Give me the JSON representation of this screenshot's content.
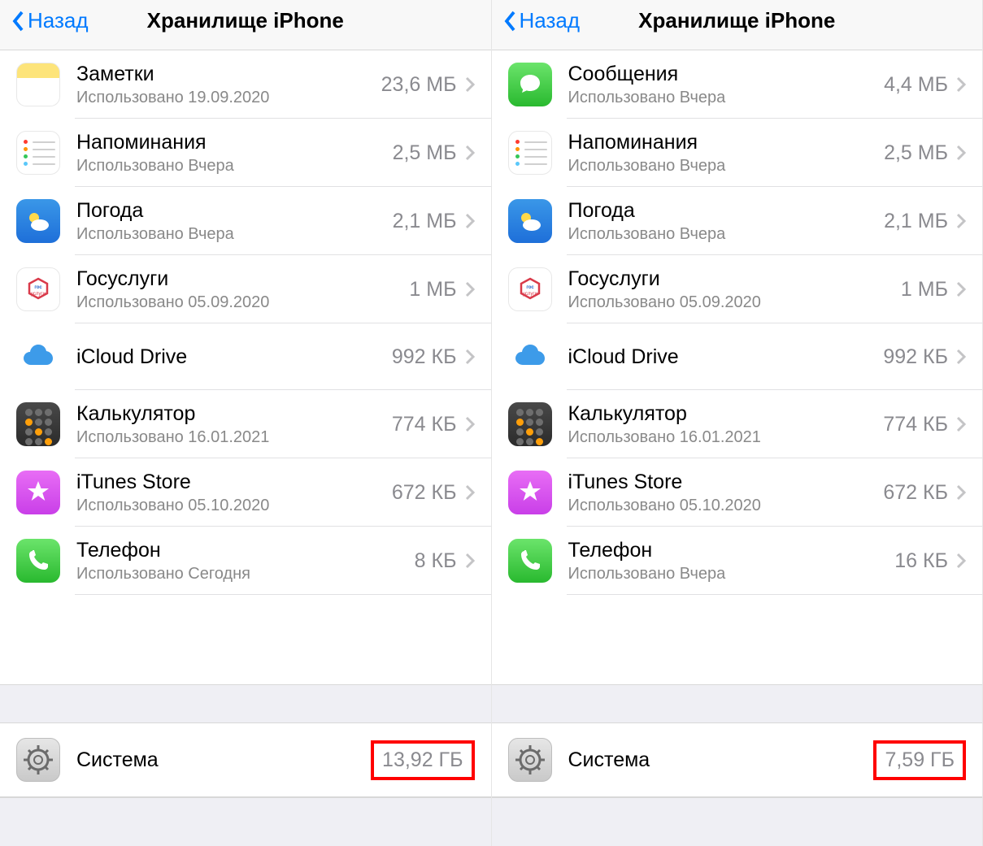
{
  "panes": [
    {
      "back_label": "Назад",
      "title": "Хранилище iPhone",
      "apps": [
        {
          "icon": "notes",
          "name": "Заметки",
          "sub": "Использовано 19.09.2020",
          "size": "23,6 МБ"
        },
        {
          "icon": "reminders",
          "name": "Напоминания",
          "sub": "Использовано Вчера",
          "size": "2,5 МБ"
        },
        {
          "icon": "weather",
          "name": "Погода",
          "sub": "Использовано Вчера",
          "size": "2,1 МБ"
        },
        {
          "icon": "gosuslugi",
          "name": "Госуслуги",
          "sub": "Использовано 05.09.2020",
          "size": "1 МБ"
        },
        {
          "icon": "icloud",
          "name": "iCloud Drive",
          "sub": "",
          "size": "992 КБ"
        },
        {
          "icon": "calc",
          "name": "Калькулятор",
          "sub": "Использовано 16.01.2021",
          "size": "774 КБ"
        },
        {
          "icon": "itunes",
          "name": "iTunes Store",
          "sub": "Использовано 05.10.2020",
          "size": "672 КБ"
        },
        {
          "icon": "phone",
          "name": "Телефон",
          "sub": "Использовано Сегодня",
          "size": "8 КБ"
        }
      ],
      "system": {
        "name": "Система",
        "size": "13,92 ГБ"
      }
    },
    {
      "back_label": "Назад",
      "title": "Хранилище iPhone",
      "apps": [
        {
          "icon": "messages",
          "name": "Сообщения",
          "sub": "Использовано Вчера",
          "size": "4,4 МБ"
        },
        {
          "icon": "reminders",
          "name": "Напоминания",
          "sub": "Использовано Вчера",
          "size": "2,5 МБ"
        },
        {
          "icon": "weather",
          "name": "Погода",
          "sub": "Использовано Вчера",
          "size": "2,1 МБ"
        },
        {
          "icon": "gosuslugi",
          "name": "Госуслуги",
          "sub": "Использовано 05.09.2020",
          "size": "1 МБ"
        },
        {
          "icon": "icloud",
          "name": "iCloud Drive",
          "sub": "",
          "size": "992 КБ"
        },
        {
          "icon": "calc",
          "name": "Калькулятор",
          "sub": "Использовано 16.01.2021",
          "size": "774 КБ"
        },
        {
          "icon": "itunes",
          "name": "iTunes Store",
          "sub": "Использовано 05.10.2020",
          "size": "672 КБ"
        },
        {
          "icon": "phone",
          "name": "Телефон",
          "sub": "Использовано Вчера",
          "size": "16 КБ"
        }
      ],
      "system": {
        "name": "Система",
        "size": "7,59 ГБ"
      }
    }
  ]
}
